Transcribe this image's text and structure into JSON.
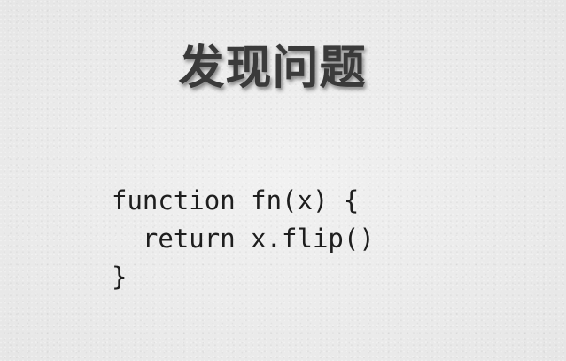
{
  "slide": {
    "title": "发现问题"
  },
  "code": {
    "lines": [
      "function fn(x) {",
      "  return x.flip()",
      "}"
    ]
  }
}
